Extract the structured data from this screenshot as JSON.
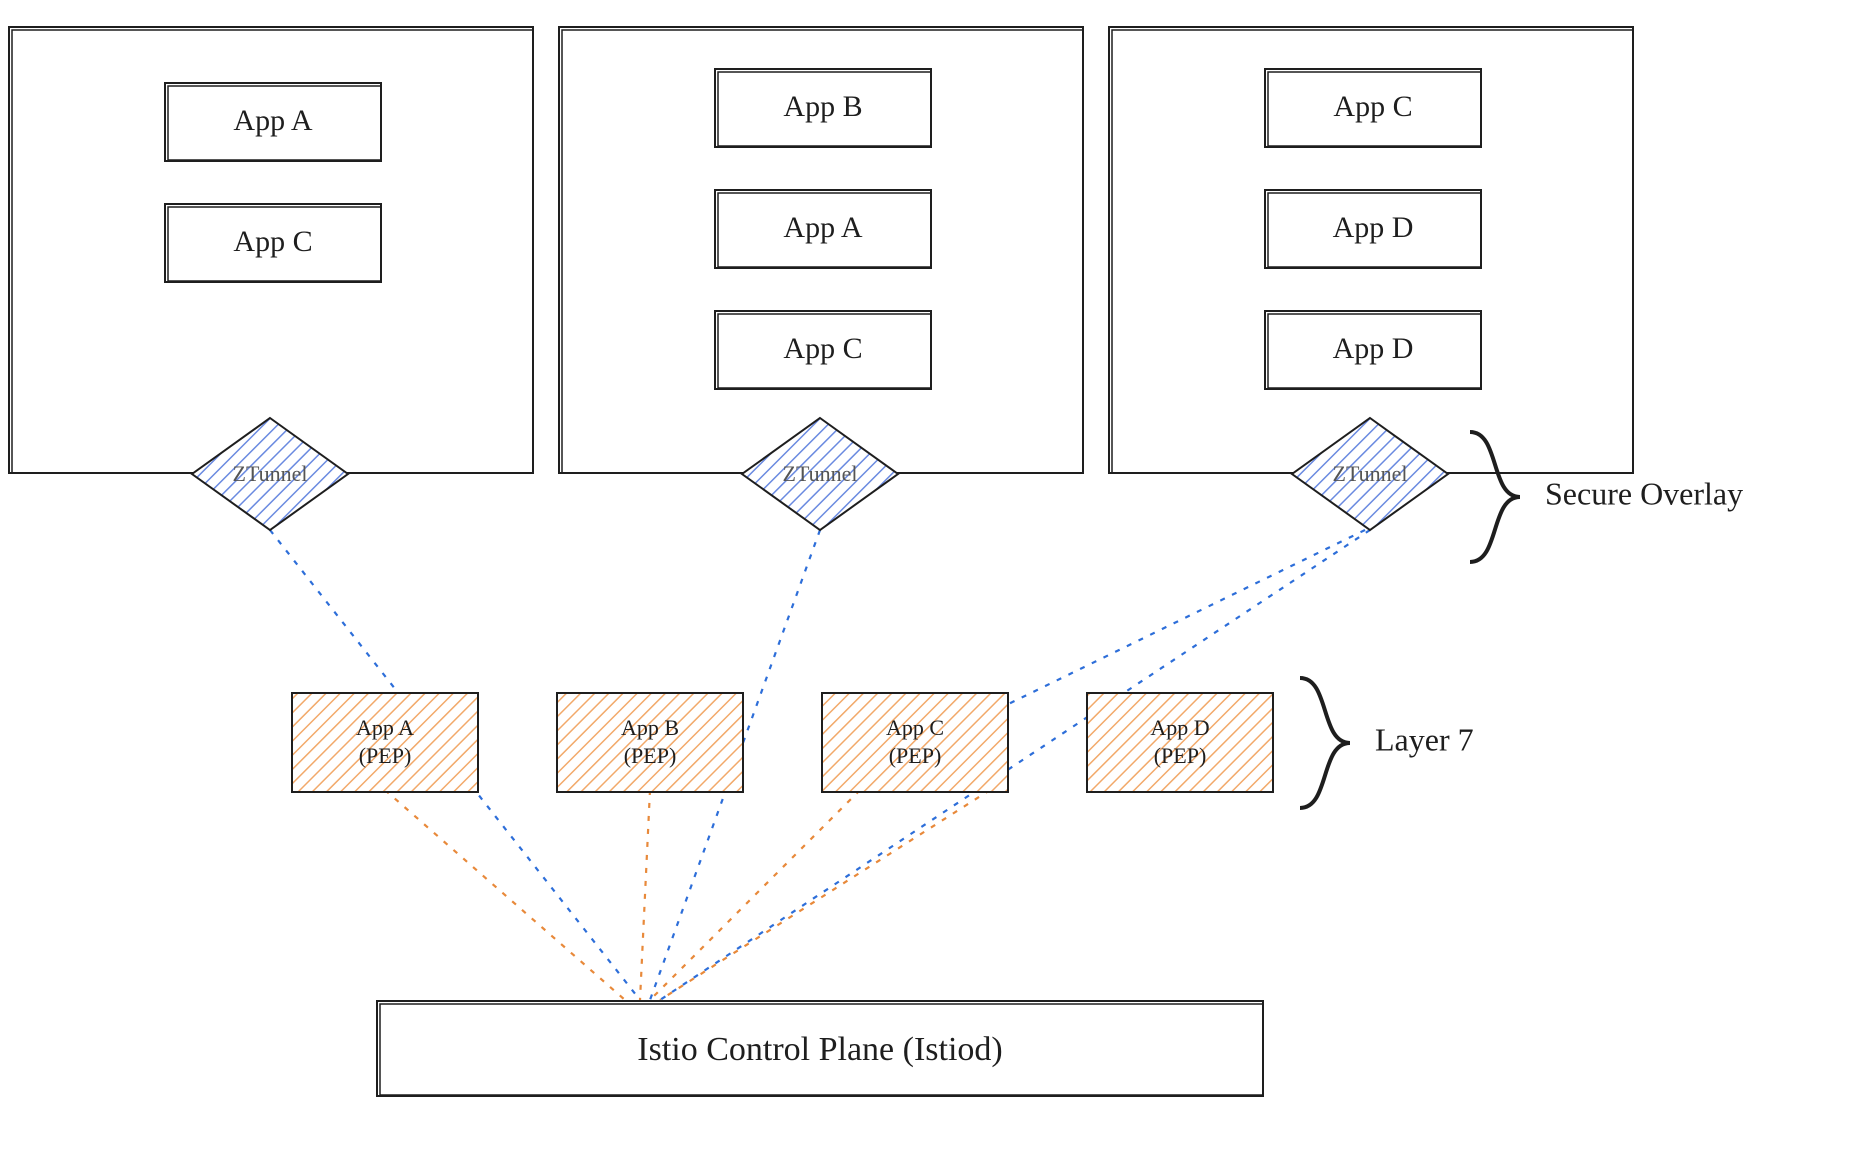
{
  "nodes": [
    {
      "apps": [
        "App A",
        "App C"
      ],
      "ztunnel": "ZTunnel"
    },
    {
      "apps": [
        "App B",
        "App A",
        "App C"
      ],
      "ztunnel": "ZTunnel"
    },
    {
      "apps": [
        "App C",
        "App D",
        "App D"
      ],
      "ztunnel": "ZTunnel"
    }
  ],
  "peps": [
    "App A\n(PEP)",
    "App B\n(PEP)",
    "App C\n(PEP)",
    "App D\n(PEP)"
  ],
  "control_plane": "Istio Control Plane (Istiod)",
  "label_secure_overlay": "Secure Overlay",
  "label_layer7": "Layer 7"
}
